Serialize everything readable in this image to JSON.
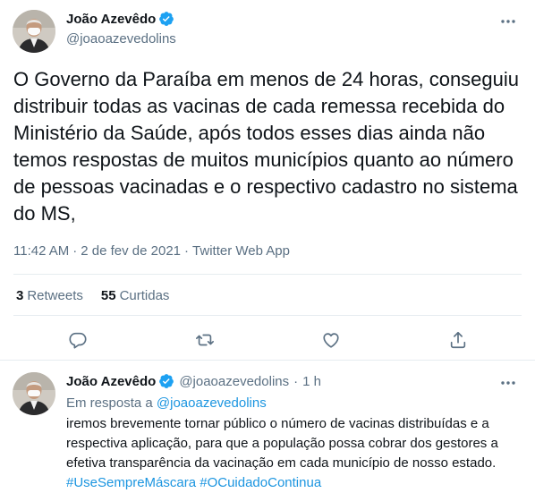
{
  "main_tweet": {
    "author": {
      "name": "João Azevêdo",
      "handle": "@joaoazevedolins"
    },
    "text": "O Governo da Paraíba em menos de 24 horas, conseguiu distribuir todas as vacinas de cada remessa recebida do Ministério da Saúde, após todos esses dias ainda não temos respostas de muitos municípios quanto ao número de pessoas vacinadas e o respectivo cadastro no sistema do MS,",
    "time": "11:42 AM",
    "date": "2 de fev de 2021",
    "source": "Twitter Web App",
    "separator": "·",
    "retweets": {
      "count": "3",
      "label": "Retweets"
    },
    "likes": {
      "count": "55",
      "label": "Curtidas"
    }
  },
  "reply_tweet": {
    "author": {
      "name": "João Azevêdo",
      "handle": "@joaoazevedolins"
    },
    "separator": "·",
    "time": "1 h",
    "reply_prefix": "Em resposta a",
    "reply_to_handle": "@joaoazevedolins",
    "text": "iremos brevemente tornar público o número de vacinas distribuídas e a respectiva aplicação, para que a população possa cobrar dos gestores a efetiva transparência da vacinação em cada município de nosso estado.",
    "hashtags": [
      "#UseSempreMáscara",
      "#OCuidadoContinua"
    ]
  },
  "colors": {
    "accent": "#1da1f2",
    "link": "#1b95e0",
    "text": "#0f1419",
    "secondary": "#5b7083",
    "border": "#e6ecf0"
  },
  "icons": {
    "verified": "verified-badge-icon",
    "more": "more-horizontal-icon",
    "reply": "reply-icon",
    "retweet": "retweet-icon",
    "like": "heart-icon",
    "share": "share-icon"
  }
}
